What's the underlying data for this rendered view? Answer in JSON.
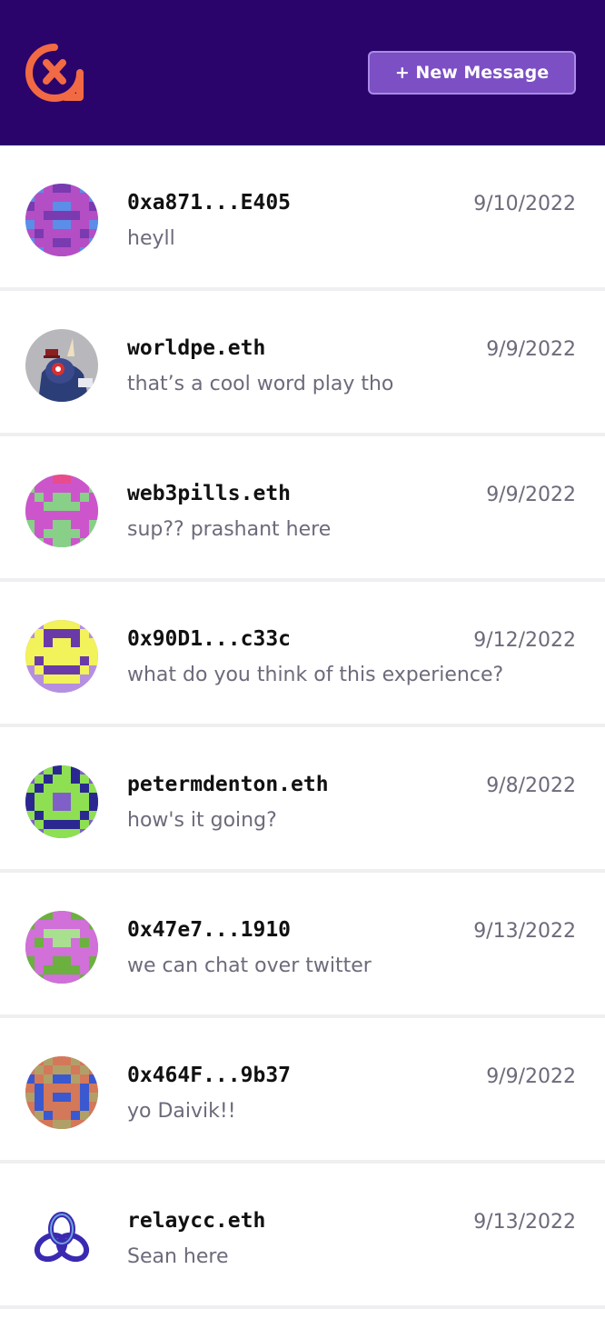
{
  "header": {
    "logo_icon": "xmtp-logo-icon",
    "new_message_label": "+ New Message",
    "colors": {
      "background": "#2a036b",
      "button": "#7c4fc4",
      "logo": "#f26a44"
    }
  },
  "conversations": [
    {
      "name": "0xa871...E405",
      "preview": "heyll",
      "date": "9/10/2022",
      "avatar": {
        "kind": "pixel",
        "bg": "#5a8ee8",
        "colors": [
          "#5a8ee8",
          "#b44ec4",
          "#7a3ab0"
        ],
        "grid": [
          "00122100",
          "01111110",
          "21100112",
          "11222211",
          "01100110",
          "12111121",
          "01122110",
          "00111100"
        ]
      }
    },
    {
      "name": "worldpe.eth",
      "preview": "that’s a cool word play tho",
      "date": "9/9/2022",
      "avatar": {
        "kind": "illustration",
        "bg": "#b8b8bc"
      }
    },
    {
      "name": "web3pills.eth",
      "preview": "sup?? prashant here",
      "date": "9/9/2022",
      "avatar": {
        "kind": "pixel",
        "bg": "#88d088",
        "colors": [
          "#88d088",
          "#cc55cc",
          "#e84c8c"
        ],
        "grid": [
          "01122110",
          "01111110",
          "10100101",
          "11000011",
          "11111111",
          "01100110",
          "01000010",
          "00100100"
        ]
      }
    },
    {
      "name": "0x90D1...c33c",
      "preview": "what do you think of this experience?",
      "date": "9/12/2022",
      "avatar": {
        "kind": "pixel",
        "bg": "#b690e0",
        "colors": [
          "#b690e0",
          "#f2f25a",
          "#6a3aa8"
        ],
        "grid": [
          "00111100",
          "01222210",
          "11211211",
          "11111111",
          "12111121",
          "01222210",
          "00111100",
          "00000000"
        ]
      }
    },
    {
      "name": "petermdenton.eth",
      "preview": "how's it going?",
      "date": "9/8/2022",
      "avatar": {
        "kind": "pixel",
        "bg": "#8060c8",
        "colors": [
          "#8060c8",
          "#8ee052",
          "#2a2890"
        ],
        "grid": [
          "00121200",
          "01211210",
          "12111121",
          "21100112",
          "21100112",
          "12111121",
          "01222210",
          "00111100"
        ]
      }
    },
    {
      "name": "0x47e7...1910",
      "preview": "we can chat over twitter",
      "date": "9/13/2022",
      "avatar": {
        "kind": "pixel",
        "bg": "#6cb040",
        "colors": [
          "#6cb040",
          "#d070d8",
          "#a8e090"
        ],
        "grid": [
          "00011000",
          "01111110",
          "11222211",
          "10122101",
          "11111111",
          "01100110",
          "01000010",
          "00111100"
        ]
      }
    },
    {
      "name": "0x464F...9b37",
      "preview": "yo Daivik!!",
      "date": "9/9/2022",
      "avatar": {
        "kind": "pixel",
        "bg": "#d4785a",
        "colors": [
          "#d4785a",
          "#3a58d0",
          "#b0a068"
        ],
        "grid": [
          "00200200",
          "02022020",
          "10211201",
          "01000010",
          "21011012",
          "01000010",
          "02100120",
          "00022000"
        ]
      }
    },
    {
      "name": "relaycc.eth",
      "preview": "Sean here",
      "date": "9/13/2022",
      "avatar": {
        "kind": "knot",
        "bg": "#ffffff",
        "color": "#3a2ab0"
      }
    }
  ]
}
